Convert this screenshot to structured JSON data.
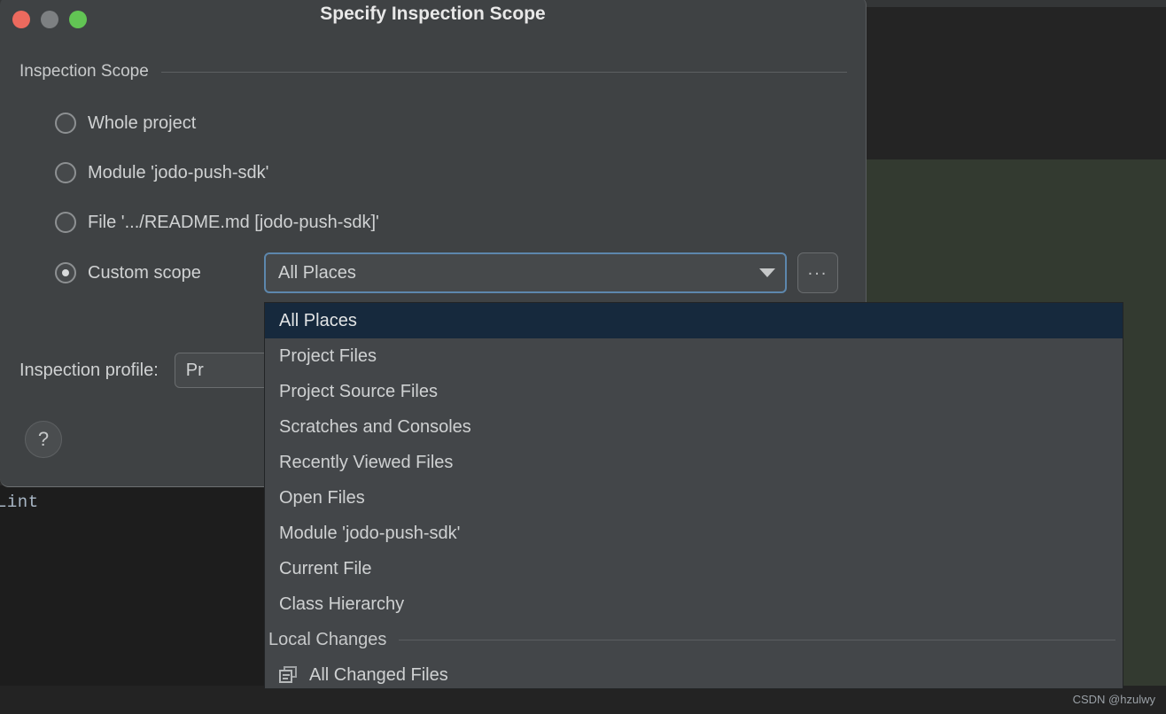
{
  "window": {
    "title": "Specify Inspection Scope",
    "traffic_lights": [
      {
        "name": "close",
        "color": "#ec6a5e"
      },
      {
        "name": "minimize",
        "color": "#7d8082"
      },
      {
        "name": "zoom",
        "color": "#62c454"
      }
    ]
  },
  "section": {
    "header": "Inspection Scope"
  },
  "scope_options": [
    {
      "label": "Whole project",
      "selected": false
    },
    {
      "label": "Module 'jodo-push-sdk'",
      "selected": false
    },
    {
      "label": "File '.../README.md [jodo-push-sdk]'",
      "selected": false
    },
    {
      "label": "Custom scope",
      "selected": true
    }
  ],
  "custom_scope": {
    "combo_value": "All Places",
    "dropdown_arrow_icon": "chevron-down-icon",
    "browse_button_label": "...",
    "browse_button_icon": "ellipsis-icon"
  },
  "profile": {
    "label": "Inspection profile:",
    "value": "Pr"
  },
  "help": {
    "icon": "question-mark-icon",
    "label": "?"
  },
  "popup": {
    "items": [
      {
        "label": "All Places",
        "selected": true,
        "type": "item"
      },
      {
        "label": "Project Files",
        "selected": false,
        "type": "item"
      },
      {
        "label": "Project Source Files",
        "selected": false,
        "type": "item"
      },
      {
        "label": "Scratches and Consoles",
        "selected": false,
        "type": "item"
      },
      {
        "label": "Recently Viewed Files",
        "selected": false,
        "type": "item"
      },
      {
        "label": "Open Files",
        "selected": false,
        "type": "item"
      },
      {
        "label": "Module 'jodo-push-sdk'",
        "selected": false,
        "type": "item"
      },
      {
        "label": "Current File",
        "selected": false,
        "type": "item"
      },
      {
        "label": "Class Hierarchy",
        "selected": false,
        "type": "item"
      },
      {
        "label": "Local Changes",
        "selected": false,
        "type": "separator"
      },
      {
        "label": "All Changed Files",
        "selected": false,
        "type": "item",
        "icon": "changed-files-icon"
      }
    ]
  },
  "background": {
    "console_text": "Lint",
    "watermark": "CSDN @hzulwy",
    "editor_color": "#242424",
    "green_panel_color": "#333a30"
  }
}
